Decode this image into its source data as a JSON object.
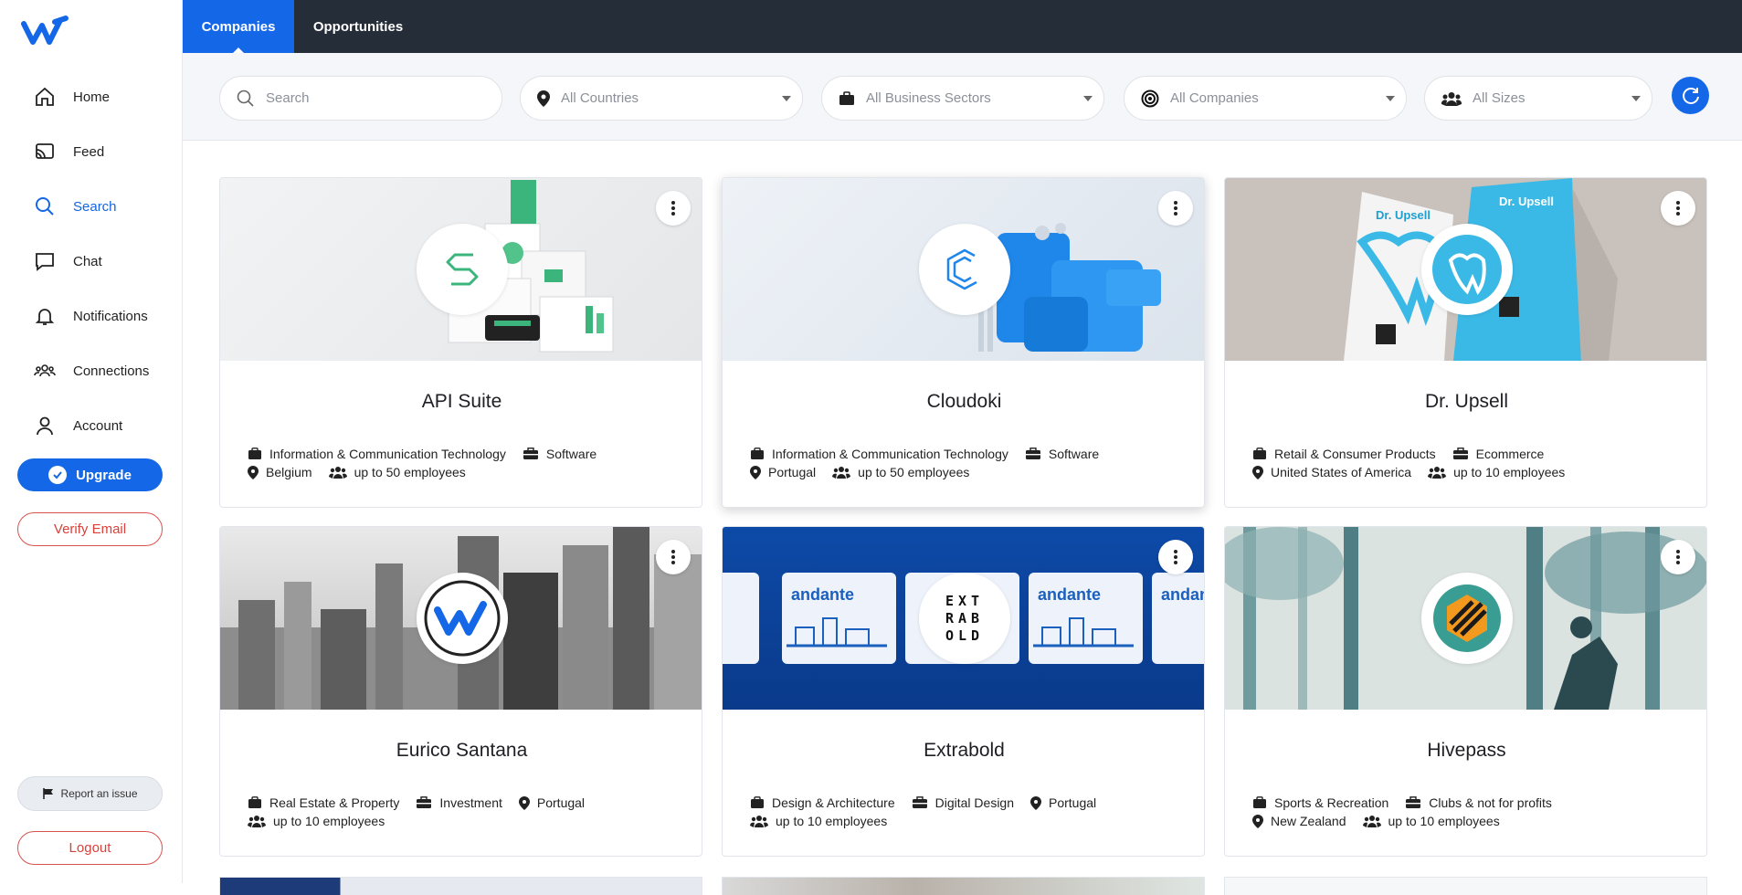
{
  "nav": {
    "items": [
      {
        "label": "Home",
        "icon": "home-icon"
      },
      {
        "label": "Feed",
        "icon": "cast-icon"
      },
      {
        "label": "Search",
        "icon": "search-icon",
        "active": true
      },
      {
        "label": "Chat",
        "icon": "chat-icon"
      },
      {
        "label": "Notifications",
        "icon": "bell-icon"
      },
      {
        "label": "Connections",
        "icon": "people-icon"
      },
      {
        "label": "Account",
        "icon": "user-icon"
      }
    ],
    "upgrade_label": "Upgrade",
    "verify_label": "Verify Email",
    "report_label": "Report an issue",
    "logout_label": "Logout"
  },
  "tabs": [
    {
      "label": "Companies",
      "active": true
    },
    {
      "label": "Opportunities",
      "active": false
    }
  ],
  "filters": {
    "search_placeholder": "Search",
    "countries": "All Countries",
    "sectors": "All Business Sectors",
    "companies": "All Companies",
    "sizes": "All Sizes"
  },
  "colors": {
    "accent": "#1467e6",
    "topbar": "#252d38",
    "danger": "#d9413b"
  },
  "cards": [
    {
      "name": "API Suite",
      "sector": "Information & Communication Technology",
      "category": "Software",
      "country": "Belgium",
      "size": "up to 50 employees"
    },
    {
      "name": "Cloudoki",
      "sector": "Information & Communication Technology",
      "category": "Software",
      "country": "Portugal",
      "size": "up to 50 employees"
    },
    {
      "name": "Dr. Upsell",
      "sector": "Retail & Consumer Products",
      "category": "Ecommerce",
      "country": "United States of America",
      "size": "up to 10 employees"
    },
    {
      "name": "Eurico Santana",
      "sector": "Real Estate & Property",
      "category": "Investment",
      "country": "Portugal",
      "size": "up to 10 employees"
    },
    {
      "name": "Extrabold",
      "sector": "Design & Architecture",
      "category": "Digital Design",
      "country": "Portugal",
      "size": "up to 10 employees"
    },
    {
      "name": "Hivepass",
      "sector": "Sports & Recreation",
      "category": "Clubs & not for profits",
      "country": "New Zealand",
      "size": "up to 10 employees"
    }
  ],
  "image_text": {
    "drupsell_brand": "Dr. Upsell",
    "andante": "andante",
    "extrabold_logo": "EXTRABOLD"
  }
}
